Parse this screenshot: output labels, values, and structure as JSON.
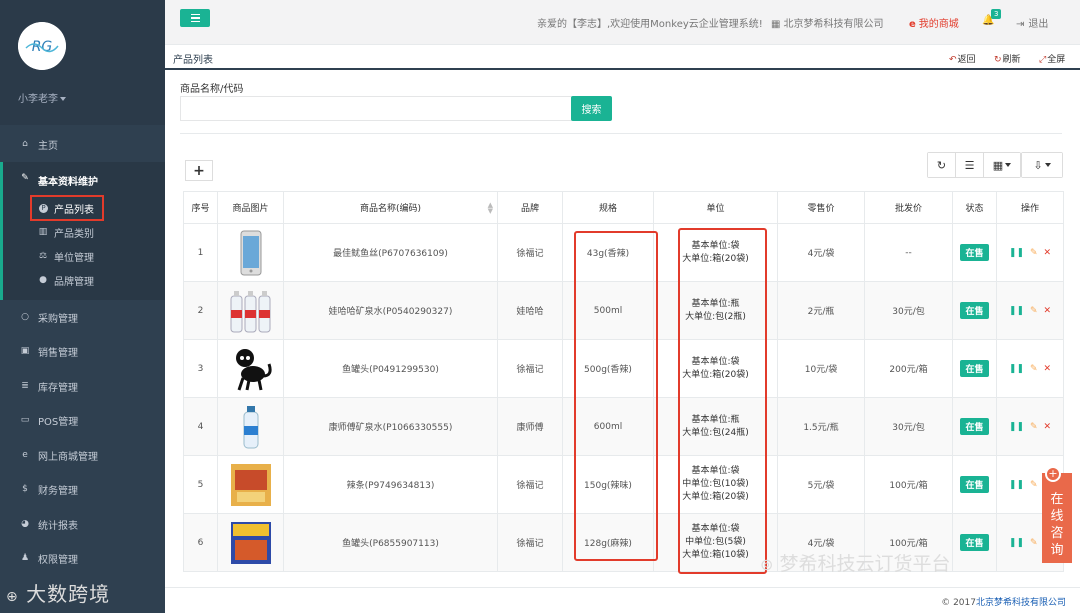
{
  "sidebar": {
    "user": "小李老李",
    "nav": [
      {
        "label": "主页",
        "icon": "home-icon"
      },
      {
        "label": "基本资料维护",
        "icon": "pencil-icon"
      },
      {
        "label": "采购管理",
        "icon": "cart-icon"
      },
      {
        "label": "销售管理",
        "icon": "money-icon"
      },
      {
        "label": "库存管理",
        "icon": "database-icon"
      },
      {
        "label": "POS管理",
        "icon": "desktop-icon"
      },
      {
        "label": "网上商城管理",
        "icon": "ie-icon"
      },
      {
        "label": "财务管理",
        "icon": "dollar-icon"
      },
      {
        "label": "统计报表",
        "icon": "pie-chart-icon"
      },
      {
        "label": "权限管理",
        "icon": "user-icon"
      }
    ],
    "sub": [
      {
        "label": "产品列表",
        "icon": "product-icon"
      },
      {
        "label": "产品类别",
        "icon": "map-icon"
      },
      {
        "label": "单位管理",
        "icon": "balance-icon"
      },
      {
        "label": "品牌管理",
        "icon": "apple-icon"
      }
    ],
    "watermark": "大数跨境"
  },
  "topbar": {
    "welcome": "亲爱的【李志】,欢迎使用Monkey云企业管理系统!",
    "company": "北京梦希科技有限公司",
    "mall": "我的商城",
    "badge": "3",
    "logout": "退出"
  },
  "crumb": {
    "title": "产品列表",
    "back": "返回",
    "refresh": "刷新",
    "fullscreen": "全屏"
  },
  "search": {
    "label": "商品名称/代码",
    "placeholder": "",
    "button": "搜索"
  },
  "table": {
    "headers": [
      "序号",
      "商品图片",
      "商品名称(编码)",
      "品牌",
      "规格",
      "单位",
      "零售价",
      "批发价",
      "状态",
      "操作"
    ],
    "rows": [
      {
        "no": "1",
        "name": "最佳鱿鱼丝(P6707636109)",
        "brand": "徐福记",
        "spec": "43g(香辣)",
        "unit": [
          "基本单位:袋",
          "大单位:箱(20袋)"
        ],
        "retail": "4元/袋",
        "wholesale": "--",
        "status": "在售",
        "img": "phone"
      },
      {
        "no": "2",
        "name": "娃哈哈矿泉水(P0540290327)",
        "brand": "娃哈哈",
        "spec": "500ml",
        "unit": [
          "基本单位:瓶",
          "大单位:包(2瓶)"
        ],
        "retail": "2元/瓶",
        "wholesale": "30元/包",
        "status": "在售",
        "img": "bottles"
      },
      {
        "no": "3",
        "name": "鱼罐头(P0491299530)",
        "brand": "徐福记",
        "spec": "500g(香辣)",
        "unit": [
          "基本单位:袋",
          "大单位:箱(20袋)"
        ],
        "retail": "10元/袋",
        "wholesale": "200元/箱",
        "status": "在售",
        "img": "monkey"
      },
      {
        "no": "4",
        "name": "康师傅矿泉水(P1066330555)",
        "brand": "康师傅",
        "spec": "600ml",
        "unit": [
          "基本单位:瓶",
          "大单位:包(24瓶)"
        ],
        "retail": "1.5元/瓶",
        "wholesale": "30元/包",
        "status": "在售",
        "img": "bottle"
      },
      {
        "no": "5",
        "name": "辣条(P9749634813)",
        "brand": "徐福记",
        "spec": "150g(辣味)",
        "unit": [
          "基本单位:袋",
          "中单位:包(10袋)",
          "大单位:箱(20袋)"
        ],
        "retail": "5元/袋",
        "wholesale": "100元/箱",
        "status": "在售",
        "img": "snack"
      },
      {
        "no": "6",
        "name": "鱼罐头(P6855907113)",
        "brand": "徐福记",
        "spec": "128g(麻辣)",
        "unit": [
          "基本单位:袋",
          "中单位:包(5袋)",
          "大单位:箱(10袋)"
        ],
        "retail": "4元/袋",
        "wholesale": "100元/箱",
        "status": "在售",
        "img": "snack2"
      }
    ]
  },
  "online": "在线咨询",
  "wechat_watermark": "梦希科技云订货平台",
  "footer": {
    "prefix": "© 2017",
    "company": "北京梦希科技有限公司"
  }
}
